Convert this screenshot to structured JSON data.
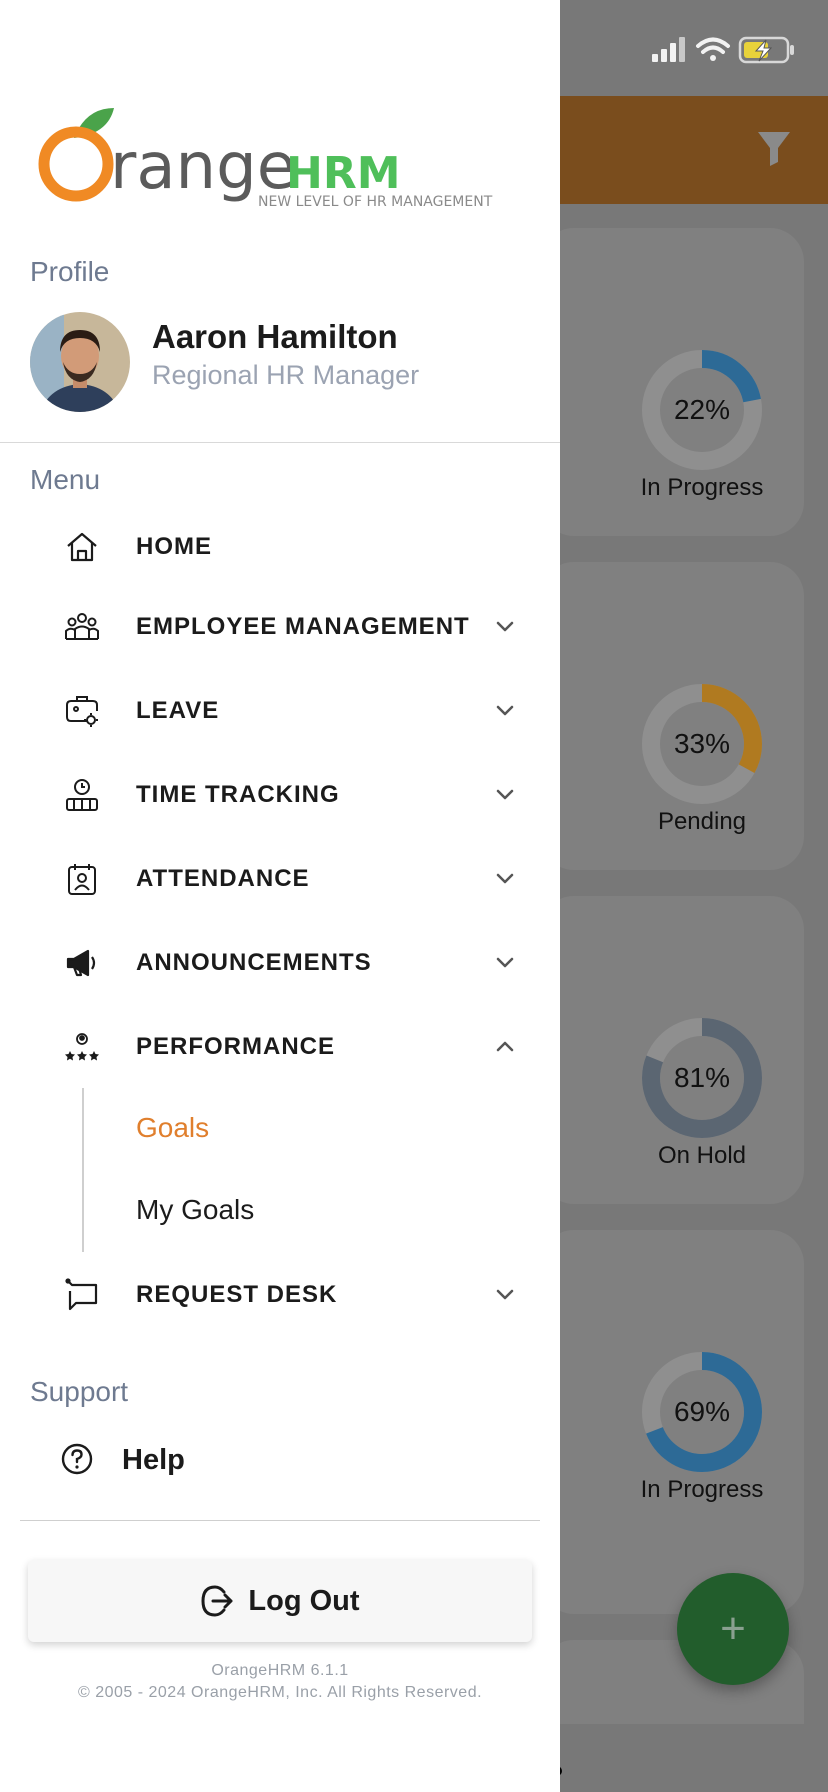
{
  "drawer": {
    "logo": {
      "brand_part1": "range",
      "brand_part2": "HRM",
      "tagline": "NEW LEVEL OF HR MANAGEMENT"
    },
    "profile_section_title": "Profile",
    "user": {
      "name": "Aaron Hamilton",
      "role": "Regional HR Manager"
    },
    "menu_section_title": "Menu",
    "menu_items": [
      {
        "label": "HOME",
        "icon": "home-icon",
        "chevron": "none"
      },
      {
        "label": "EMPLOYEE MANAGEMENT",
        "icon": "people-group-icon",
        "chevron": "down"
      },
      {
        "label": "LEAVE",
        "icon": "leave-icon",
        "chevron": "down"
      },
      {
        "label": "TIME TRACKING",
        "icon": "time-tracking-icon",
        "chevron": "down"
      },
      {
        "label": "ATTENDANCE",
        "icon": "attendance-icon",
        "chevron": "down"
      },
      {
        "label": "ANNOUNCEMENTS",
        "icon": "megaphone-icon",
        "chevron": "down"
      },
      {
        "label": "PERFORMANCE",
        "icon": "performance-icon",
        "chevron": "up"
      },
      {
        "label": "REQUEST DESK",
        "icon": "request-desk-icon",
        "chevron": "down"
      }
    ],
    "performance_subitems": [
      {
        "label": "Goals",
        "active": true
      },
      {
        "label": "My Goals",
        "active": false
      }
    ],
    "support_section_title": "Support",
    "help_label": "Help",
    "logout_label": "Log Out",
    "footer_version": "OrangeHRM 6.1.1",
    "footer_copyright": "© 2005 - 2024 OrangeHRM, Inc. All Rights Reserved."
  },
  "background": {
    "cards": [
      {
        "percent_label": "22%",
        "percent": 22,
        "status": "In Progress",
        "color": "#2d6a96"
      },
      {
        "percent_label": "33%",
        "percent": 33,
        "status": "Pending",
        "color": "#b07a20"
      },
      {
        "percent_label": "81%",
        "percent": 81,
        "status": "On Hold",
        "color": "#5b6672"
      },
      {
        "percent_label": "69%",
        "percent": 69,
        "status": "In Progress",
        "color": "#2d6a96"
      }
    ],
    "fab_label": "+"
  },
  "colors": {
    "accent": "#e07f2d",
    "header": "#7a4d1d",
    "fab": "#225d2c"
  }
}
